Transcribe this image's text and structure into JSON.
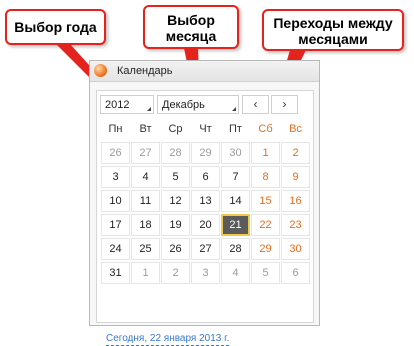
{
  "callouts": {
    "year": "Выбор года",
    "month": "Выбор\nмесяца",
    "nav": "Переходы между\nмесяцами"
  },
  "window": {
    "title": "Календарь",
    "icon": "app-icon"
  },
  "controls": {
    "year_value": "2012",
    "month_value": "Декабрь",
    "prev_symbol": "‹",
    "next_symbol": "›"
  },
  "weekdays": [
    "Пн",
    "Вт",
    "Ср",
    "Чт",
    "Пт",
    "Сб",
    "Вс"
  ],
  "weeks": [
    [
      "26",
      "27",
      "28",
      "29",
      "30",
      "1",
      "2"
    ],
    [
      "3",
      "4",
      "5",
      "6",
      "7",
      "8",
      "9"
    ],
    [
      "10",
      "11",
      "12",
      "13",
      "14",
      "15",
      "16"
    ],
    [
      "17",
      "18",
      "19",
      "20",
      "21",
      "22",
      "23"
    ],
    [
      "24",
      "25",
      "26",
      "27",
      "28",
      "29",
      "30"
    ],
    [
      "31",
      "1",
      "2",
      "3",
      "4",
      "5",
      "6"
    ]
  ],
  "selected_day": "21",
  "today_link": "Сегодня, 22 января 2013 г.",
  "colors": {
    "callout_border": "#e4231c",
    "weekend": "#e56e1e",
    "muted": "#9b9b9b",
    "selected_bg": "#5b5b5b",
    "selected_border": "#f2c84b",
    "link": "#3a78c9"
  }
}
